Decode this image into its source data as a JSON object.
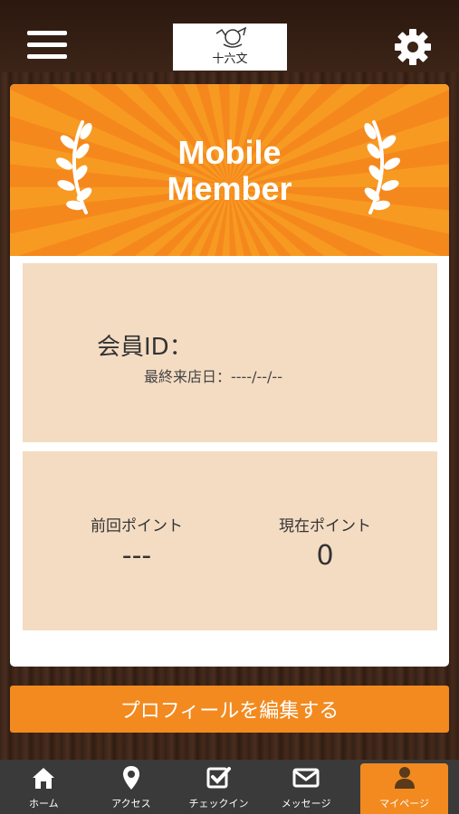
{
  "header": {
    "menu_icon": "hamburger-menu-icon",
    "logo_text": "十六文",
    "settings_icon": "gear-icon"
  },
  "banner": {
    "title_line1": "Mobile",
    "title_line2": "Member"
  },
  "member": {
    "id_label": "会員ID：",
    "last_visit_label": "最終来店日：----/--/--"
  },
  "points": {
    "previous_label": "前回ポイント",
    "previous_value": "---",
    "current_label": "現在ポイント",
    "current_value": "0"
  },
  "edit_profile_label": "プロフィールを編集する",
  "tabs": [
    {
      "label": "ホーム",
      "icon": "home-icon"
    },
    {
      "label": "アクセス",
      "icon": "location-pin-icon"
    },
    {
      "label": "チェックイン",
      "icon": "checkbox-icon"
    },
    {
      "label": "メッセージ",
      "icon": "envelope-icon"
    },
    {
      "label": "マイページ",
      "icon": "person-icon"
    }
  ],
  "colors": {
    "accent": "#f28a1f",
    "banner_orange": "#f79a22",
    "panel_beige": "#f4dcc3",
    "tabbar": "#3a3a3a"
  }
}
